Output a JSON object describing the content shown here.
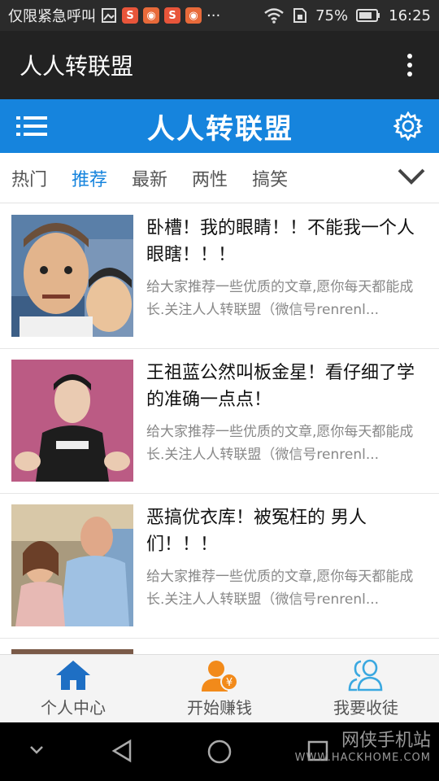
{
  "status_bar": {
    "carrier": "仅限紧急呼叫",
    "battery": "75%",
    "time": "16:25",
    "more": "···"
  },
  "app_bar": {
    "title": "人人转联盟"
  },
  "blue_bar": {
    "brand": "人人转联盟"
  },
  "tabs": [
    {
      "label": "热门"
    },
    {
      "label": "推荐"
    },
    {
      "label": "最新"
    },
    {
      "label": "两性"
    },
    {
      "label": "搞笑"
    }
  ],
  "active_tab": "推荐",
  "articles": [
    {
      "title": "卧槽！我的眼睛！！不能我一个人眼瞎！！！",
      "summary": "给大家推荐一些优质的文章,愿你每天都能成长.关注人人转联盟（微信号renrenl..."
    },
    {
      "title": "王祖蓝公然叫板金星！看仔细了学的准确一点点！",
      "summary": "给大家推荐一些优质的文章,愿你每天都能成长.关注人人转联盟（微信号renrenl..."
    },
    {
      "title": "恶搞优衣库！被冤枉的 男人们！！！",
      "summary": "给大家推荐一些优质的文章,愿你每天都能成长.关注人人转联盟（微信号renrenl..."
    }
  ],
  "bottom_nav": [
    {
      "label": "个人中心",
      "icon": "home-icon"
    },
    {
      "label": "开始赚钱",
      "icon": "earn-money-icon"
    },
    {
      "label": "我要收徒",
      "icon": "recruit-users-icon"
    }
  ],
  "watermark": {
    "line1": "网侠手机站",
    "line2": "WWW.HACKHOME.COM"
  },
  "colors": {
    "accent": "#1684dd",
    "home_icon": "#1e6fc4",
    "earn_icon": "#f28a1a",
    "recruit_icon": "#3aa8e0"
  }
}
